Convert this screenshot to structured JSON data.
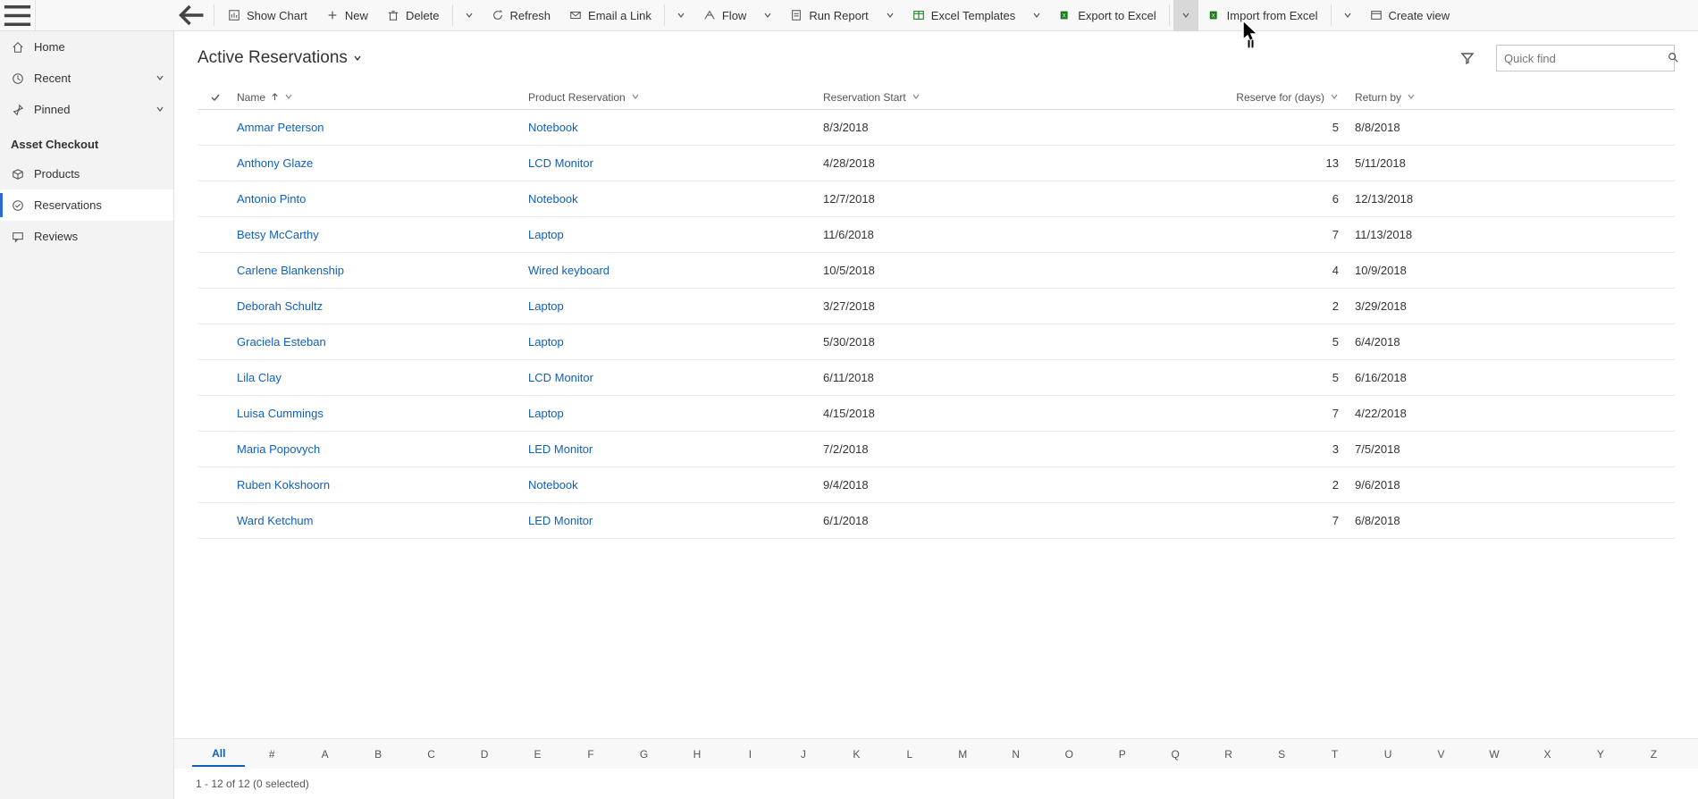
{
  "commands": {
    "show_chart": "Show Chart",
    "new": "New",
    "delete": "Delete",
    "refresh": "Refresh",
    "email_link": "Email a Link",
    "flow": "Flow",
    "run_report": "Run Report",
    "excel_templates": "Excel Templates",
    "export_excel": "Export to Excel",
    "import_excel": "Import from Excel",
    "create_view": "Create view"
  },
  "nav": {
    "home": "Home",
    "recent": "Recent",
    "pinned": "Pinned",
    "section_header": "Asset Checkout",
    "products": "Products",
    "reservations": "Reservations",
    "reviews": "Reviews"
  },
  "view": {
    "title": "Active Reservations",
    "quick_find_placeholder": "Quick find",
    "columns": {
      "name": "Name",
      "product": "Product Reservation",
      "start": "Reservation Start",
      "days": "Reserve for (days)",
      "return": "Return by"
    }
  },
  "rows": [
    {
      "name": "Ammar Peterson",
      "product": "Notebook",
      "start": "8/3/2018",
      "days": "5",
      "return": "8/8/2018"
    },
    {
      "name": "Anthony Glaze",
      "product": "LCD Monitor",
      "start": "4/28/2018",
      "days": "13",
      "return": "5/11/2018"
    },
    {
      "name": "Antonio Pinto",
      "product": "Notebook",
      "start": "12/7/2018",
      "days": "6",
      "return": "12/13/2018"
    },
    {
      "name": "Betsy McCarthy",
      "product": "Laptop",
      "start": "11/6/2018",
      "days": "7",
      "return": "11/13/2018"
    },
    {
      "name": "Carlene Blankenship",
      "product": "Wired keyboard",
      "start": "10/5/2018",
      "days": "4",
      "return": "10/9/2018"
    },
    {
      "name": "Deborah Schultz",
      "product": "Laptop",
      "start": "3/27/2018",
      "days": "2",
      "return": "3/29/2018"
    },
    {
      "name": "Graciela Esteban",
      "product": "Laptop",
      "start": "5/30/2018",
      "days": "5",
      "return": "6/4/2018"
    },
    {
      "name": "Lila Clay",
      "product": "LCD Monitor",
      "start": "6/11/2018",
      "days": "5",
      "return": "6/16/2018"
    },
    {
      "name": "Luisa Cummings",
      "product": "Laptop",
      "start": "4/15/2018",
      "days": "7",
      "return": "4/22/2018"
    },
    {
      "name": "Maria Popovych",
      "product": "LED Monitor",
      "start": "7/2/2018",
      "days": "3",
      "return": "7/5/2018"
    },
    {
      "name": "Ruben Kokshoorn",
      "product": "Notebook",
      "start": "9/4/2018",
      "days": "2",
      "return": "9/6/2018"
    },
    {
      "name": "Ward Ketchum",
      "product": "LED Monitor",
      "start": "6/1/2018",
      "days": "7",
      "return": "6/8/2018"
    }
  ],
  "alpha": [
    "All",
    "#",
    "A",
    "B",
    "C",
    "D",
    "E",
    "F",
    "G",
    "H",
    "I",
    "J",
    "K",
    "L",
    "M",
    "N",
    "O",
    "P",
    "Q",
    "R",
    "S",
    "T",
    "U",
    "V",
    "W",
    "X",
    "Y",
    "Z"
  ],
  "alpha_active": "All",
  "status": "1 - 12 of 12 (0 selected)"
}
